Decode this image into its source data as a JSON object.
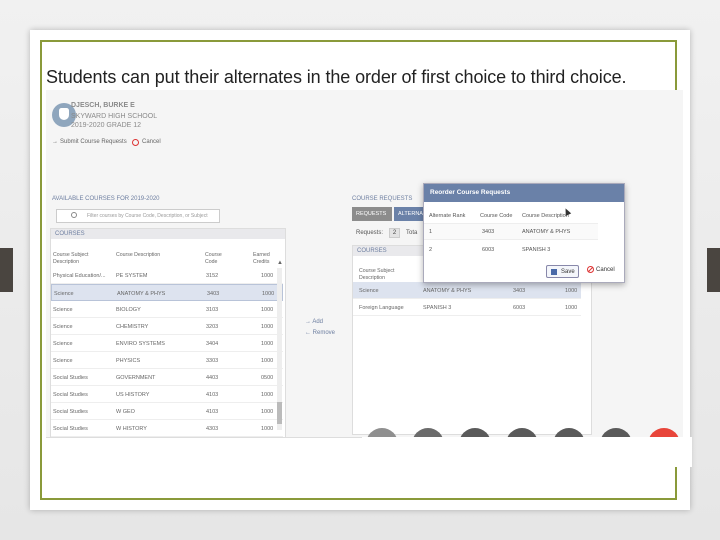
{
  "caption": "Students can put their alternates in the order of first choice to third choice.",
  "header": {
    "student_name": "DJESCH, BURKE E",
    "school": "SKYWARD HIGH SCHOOL",
    "year_grade": "2019-2020 GRADE 12"
  },
  "breadcrumb": {
    "item1": "Submit Course Requests",
    "cancel": "Cancel"
  },
  "left": {
    "section_title": "AVAILABLE COURSES FOR 2019-2020",
    "search_placeholder": "Filter courses by Course Code, Description, or Subject",
    "panel_title": "COURSES",
    "columns": [
      "Course Subject Description",
      "Course Description",
      "Course Code",
      "Earned Credits"
    ],
    "rows": [
      [
        "Physical Education/...",
        "PE SYSTEM",
        "3152",
        "1000"
      ],
      [
        "Science",
        "ANATOMY & PHYS",
        "3403",
        "1000"
      ],
      [
        "Science",
        "BIOLOGY",
        "3103",
        "1000"
      ],
      [
        "Science",
        "CHEMISTRY",
        "3203",
        "1000"
      ],
      [
        "Science",
        "ENVIRO SYSTEMS",
        "3404",
        "1000"
      ],
      [
        "Science",
        "PHYSICS",
        "3303",
        "1000"
      ],
      [
        "Social Studies",
        "GOVERNMENT",
        "4403",
        "0500"
      ],
      [
        "Social Studies",
        "US HISTORY",
        "4103",
        "1000"
      ],
      [
        "Social Studies",
        "W GEO",
        "4103",
        "1000"
      ],
      [
        "Social Studies",
        "W HISTORY",
        "4303",
        "1000"
      ]
    ]
  },
  "mover": {
    "add": "Add",
    "remove": "Remove"
  },
  "right": {
    "section_title": "COURSE REQUESTS",
    "tab_requests": "REQUESTS",
    "tab_alternates": "ALTERNA",
    "requests_label": "Requests:",
    "requests_count": "2",
    "total_label": "Tota",
    "panel_title": "COURSES",
    "columns": [
      "Course Subject Description"
    ],
    "rows": [
      [
        "Science",
        "ANATOMY & PHYS",
        "3403",
        "1000"
      ],
      [
        "Foreign Language",
        "SPANISH 3",
        "6003",
        "1000"
      ]
    ]
  },
  "modal": {
    "title": "Reorder Course Requests",
    "columns": [
      "Alternate Rank",
      "Course Code",
      "Course Description"
    ],
    "rows": [
      [
        "1",
        "3403",
        "ANATOMY & PHYS"
      ],
      [
        "2",
        "6003",
        "SPANISH 3"
      ]
    ],
    "save_label": "Save",
    "cancel_label": "Cancel"
  },
  "colors": {
    "frame": "#8a9a3a",
    "modal_header": "#6a81a8",
    "selection": "#dde3ef",
    "dots": [
      "#8f8f8f",
      "#6b6b6b",
      "#5a5a5a",
      "#5a5a5a",
      "#5a5a5a",
      "#5a5a5a",
      "#5a5a5a",
      "#e8453a"
    ]
  }
}
